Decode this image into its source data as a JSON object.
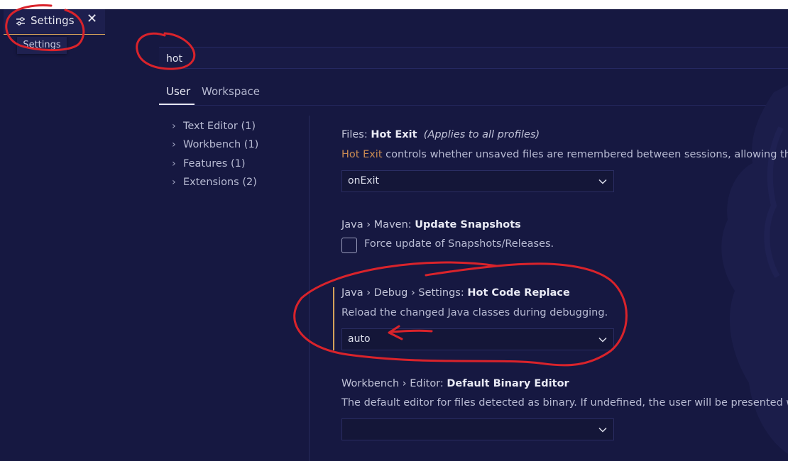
{
  "tab": {
    "title": "Settings",
    "close_glyph": "✕",
    "icon": "settings-sliders-icon"
  },
  "breadcrumb": {
    "label": "Settings"
  },
  "search": {
    "value": "hot",
    "placeholder": ""
  },
  "scopes": {
    "user": "User",
    "workspace": "Workspace",
    "active": "User"
  },
  "toc": [
    {
      "label": "Text Editor (1)"
    },
    {
      "label": "Workbench (1)"
    },
    {
      "label": "Features (1)"
    },
    {
      "label": "Extensions (2)"
    }
  ],
  "settings": {
    "hot_exit": {
      "category": "Files: ",
      "name": "Hot Exit",
      "note": "(Applies to all profiles)",
      "desc_link": "Hot Exit",
      "desc_rest": " controls whether unsaved files are remembered between sessions, allowing the save",
      "value": "onExit"
    },
    "maven_snapshots": {
      "cat1": "Java",
      "cat2": "Maven: ",
      "name": "Update Snapshots",
      "checkbox_label": "Force update of Snapshots/Releases."
    },
    "hot_code_replace": {
      "cat1": "Java",
      "cat2": "Debug",
      "cat3": "Settings: ",
      "name": "Hot Code Replace",
      "desc": "Reload the changed Java classes during debugging.",
      "value": "auto"
    },
    "binary_editor": {
      "cat1": "Workbench",
      "cat2": "Editor: ",
      "name": "Default Binary Editor",
      "desc": "The default editor for files detected as binary. If undefined, the user will be presented with a",
      "value": ""
    }
  },
  "colors": {
    "background": "#161841",
    "accent_modified": "#d4a25a",
    "link": "#c98a52",
    "annotation": "#d9232b"
  }
}
